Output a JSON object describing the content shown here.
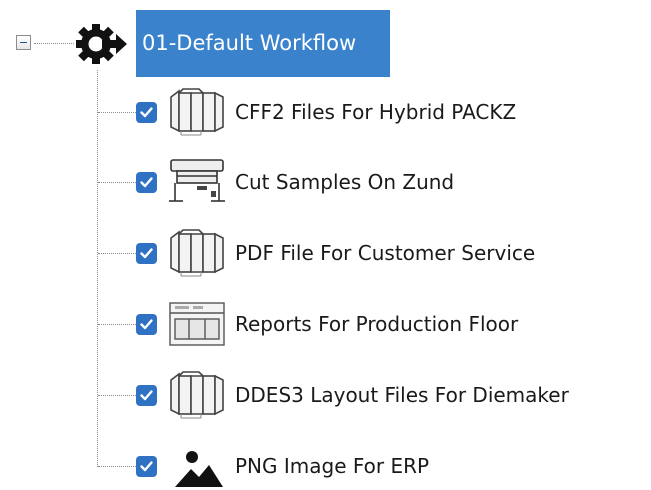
{
  "colors": {
    "selection_bg": "#3a83cc",
    "checkbox": "#2f72c4",
    "text": "#1a1a1a",
    "connector": "#8c8c8c"
  },
  "root": {
    "label": "01-Default Workflow",
    "icon": "workflow-gear-icon",
    "expanded": true,
    "selected": true
  },
  "children": [
    {
      "label": "CFF2 Files For Hybrid PACKZ",
      "icon": "folding-box-icon",
      "checked": true
    },
    {
      "label": "Cut Samples On Zund",
      "icon": "plotter-icon",
      "checked": true
    },
    {
      "label": "PDF File For Customer Service",
      "icon": "folding-box-icon",
      "checked": true
    },
    {
      "label": "Reports For Production Floor",
      "icon": "report-layout-icon",
      "checked": true
    },
    {
      "label": "DDES3 Layout Files For Diemaker",
      "icon": "folding-box-icon",
      "checked": true
    },
    {
      "label": "PNG Image For ERP",
      "icon": "image-icon",
      "checked": true
    }
  ]
}
